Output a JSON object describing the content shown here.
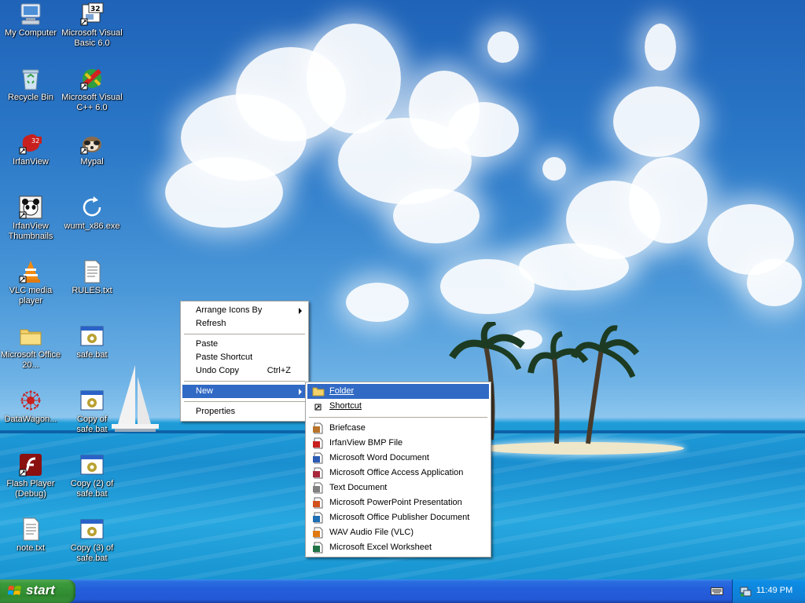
{
  "desktop_icons": [
    {
      "label": "My Computer",
      "icon": "computer-icon"
    },
    {
      "label": "Microsoft Visual Basic 6.0",
      "icon": "vb6-icon"
    },
    {
      "label": "Recycle Bin",
      "icon": "recycle-bin-icon"
    },
    {
      "label": "Microsoft Visual C++ 6.0",
      "icon": "vc6-icon"
    },
    {
      "label": "IrfanView",
      "icon": "irfanview-icon"
    },
    {
      "label": "Mypal",
      "icon": "mypal-icon"
    },
    {
      "label": "IrfanView Thumbnails",
      "icon": "irfanview-thumbnails-icon"
    },
    {
      "label": "wumt_x86.exe",
      "icon": "refresh-arrow-icon"
    },
    {
      "label": "VLC media player",
      "icon": "vlc-icon"
    },
    {
      "label": "RULES.txt",
      "icon": "text-file-icon"
    },
    {
      "label": "Microsoft Office 20...",
      "icon": "folder-icon"
    },
    {
      "label": "safe.bat",
      "icon": "batch-file-icon"
    },
    {
      "label": "DataWagon...",
      "icon": "datawagon-icon"
    },
    {
      "label": "Copy of safe.bat",
      "icon": "batch-file-icon"
    },
    {
      "label": "Flash Player (Debug)",
      "icon": "flash-player-icon"
    },
    {
      "label": "Copy (2) of safe.bat",
      "icon": "batch-file-icon"
    },
    {
      "label": "note.txt",
      "icon": "text-file-icon"
    },
    {
      "label": "Copy (3) of safe.bat",
      "icon": "batch-file-icon"
    }
  ],
  "context_menu": {
    "arrange_icons_by": "Arrange Icons By",
    "refresh": "Refresh",
    "paste": "Paste",
    "paste_shortcut": "Paste Shortcut",
    "undo_copy": "Undo Copy",
    "undo_copy_shortcut": "Ctrl+Z",
    "new": "New",
    "properties": "Properties"
  },
  "new_submenu": {
    "folder": "Folder",
    "shortcut": "Shortcut",
    "items": [
      {
        "label": "Briefcase",
        "icon": "briefcase-icon",
        "color": "#b8742a"
      },
      {
        "label": "IrfanView BMP File",
        "icon": "irfanview-bmp-icon",
        "color": "#c8201e"
      },
      {
        "label": "Microsoft Word Document",
        "icon": "word-document-icon",
        "color": "#2b5bb5"
      },
      {
        "label": "Microsoft Office Access Application",
        "icon": "access-icon",
        "color": "#a8283a"
      },
      {
        "label": "Text Document",
        "icon": "text-document-icon",
        "color": "#808080"
      },
      {
        "label": "Microsoft PowerPoint Presentation",
        "icon": "powerpoint-icon",
        "color": "#d2521e"
      },
      {
        "label": "Microsoft Office Publisher Document",
        "icon": "publisher-icon",
        "color": "#1e6fb5"
      },
      {
        "label": "WAV Audio File (VLC)",
        "icon": "wav-audio-icon",
        "color": "#e07a10"
      },
      {
        "label": "Microsoft Excel Worksheet",
        "icon": "excel-icon",
        "color": "#217346"
      }
    ]
  },
  "taskbar": {
    "start_label": "start",
    "clock": "11:49 PM"
  },
  "colors": {
    "highlight": "#316ac5",
    "taskbar": "#245edb",
    "start_button": "#3c9a3c"
  }
}
